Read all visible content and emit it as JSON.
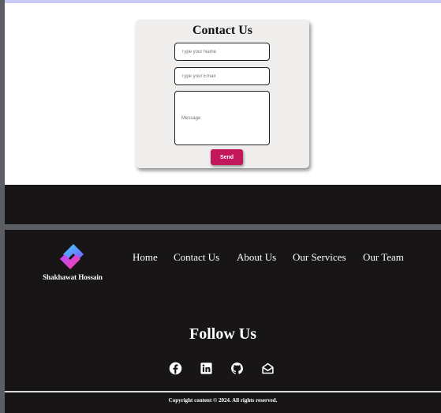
{
  "contact": {
    "title": "Contact Us",
    "name_placeholder": "Type your Name",
    "email_placeholder": "Type your Email",
    "message_placeholder": "Message",
    "send_label": "Send"
  },
  "footer": {
    "brand_name": "Shakhawat Hossain",
    "nav": [
      "Home",
      "Contact Us",
      "About Us",
      "Our Services",
      "Our Team"
    ],
    "follow_title": "Follow Us",
    "social_icons": [
      "facebook-icon",
      "linkedin-icon",
      "github-icon",
      "email-icon"
    ],
    "copyright": "Copyright content © 2024. All rights reserved."
  },
  "colors": {
    "send_button": "#c2185b",
    "footer_bg": "#171516",
    "page_bg": "#5b5e62",
    "top_strip": "#c9c9f5",
    "card_bg": "#efeeed"
  }
}
